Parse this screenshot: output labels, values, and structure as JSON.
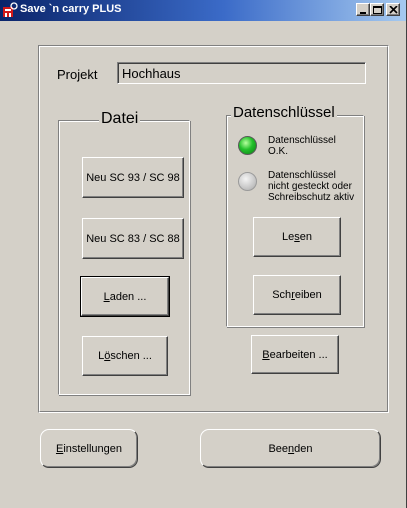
{
  "window": {
    "title": "Save `n carry PLUS",
    "app_icon": "save-n-carry-app-icon",
    "controls": {
      "minimize": "minimize-icon",
      "maximize": "maximize-icon",
      "close": "close-icon"
    }
  },
  "projekt": {
    "label": "Projekt",
    "value": "Hochhaus"
  },
  "datei": {
    "title": "Datei",
    "buttons": {
      "neu_sc93": "Neu SC 93 / SC 98",
      "neu_sc83": "Neu SC 83 / SC 88",
      "laden_pre": "",
      "laden_u": "L",
      "laden_post": "aden ...",
      "loeschen_pre": "L",
      "loeschen_u": "ö",
      "loeschen_post": "schen ..."
    }
  },
  "datenschluessel": {
    "title": "Datenschlüssel",
    "status_ok": {
      "line1": "Datenschlüssel",
      "line2": "O.K.",
      "color": "#22c02a"
    },
    "status_error": {
      "line1": "Datenschlüssel",
      "line2": "nicht gesteckt oder",
      "line3": "Schreibschutz aktiv",
      "color": "#cfcfcf"
    },
    "buttons": {
      "lesen_pre": "Le",
      "lesen_u": "s",
      "lesen_post": "en",
      "schreiben_pre": "Sch",
      "schreiben_u": "r",
      "schreiben_post": "eiben"
    }
  },
  "bearbeiten": {
    "pre": "",
    "u": "B",
    "post": "earbeiten ..."
  },
  "bottom": {
    "einstellungen": {
      "pre": "",
      "u": "E",
      "post": "instellungen"
    },
    "beenden": {
      "pre": "Bee",
      "u": "n",
      "post": "den"
    }
  },
  "colors": {
    "face": "#d4d0c8",
    "titlebar_start": "#0a246a",
    "titlebar_end": "#a6caf0",
    "led_ok": "#22c02a"
  }
}
